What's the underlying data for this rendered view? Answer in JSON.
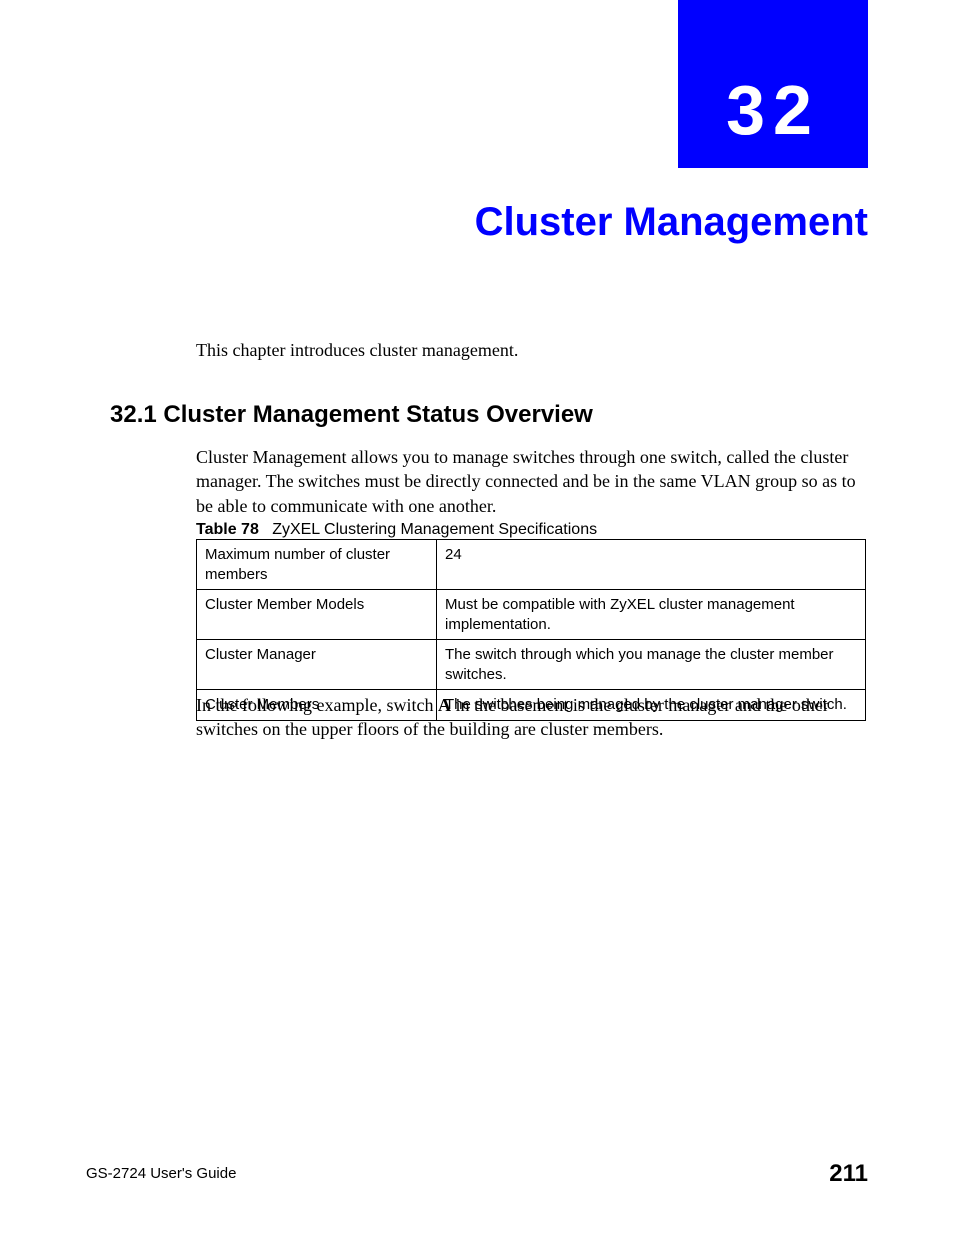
{
  "chapter": {
    "number": "32",
    "title": "Cluster Management"
  },
  "intro": "This chapter introduces cluster management.",
  "section": {
    "heading": "32.1  Cluster Management Status Overview",
    "body": "Cluster Management allows you to manage switches through one switch, called the cluster manager. The switches must be directly connected and be in the same VLAN group so as to be able to communicate with one another."
  },
  "table": {
    "caption_label": "Table 78",
    "caption_text": "ZyXEL Clustering Management Specifications",
    "rows": [
      {
        "label": "Maximum number of cluster members",
        "value": "24"
      },
      {
        "label": "Cluster Member Models",
        "value": "Must be compatible with ZyXEL cluster management implementation."
      },
      {
        "label": "Cluster Manager",
        "value": "The switch through which you manage the cluster member switches."
      },
      {
        "label": "Cluster Members",
        "value": "The switches being managed by the cluster manager switch."
      }
    ]
  },
  "post_table": {
    "pre": "In the following example, switch ",
    "bold": "A",
    "post": " in the basement is the cluster manager and the other switches on the upper floors of the building are cluster members."
  },
  "footer": {
    "left": "GS-2724 User's Guide",
    "right": "211"
  }
}
